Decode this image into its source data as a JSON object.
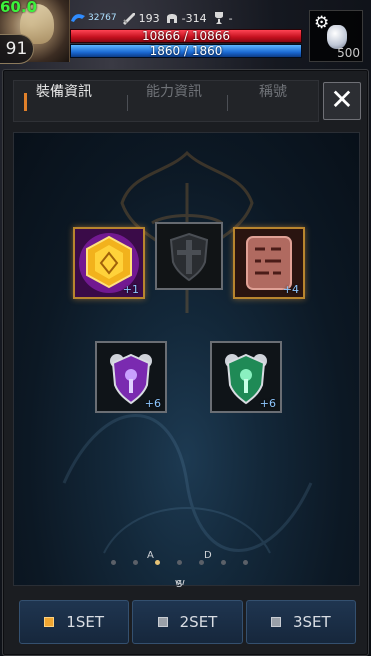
{
  "hud": {
    "fps": "60.0",
    "level": "91",
    "stats": [
      {
        "icon": "mana-wave-icon",
        "value": "32767"
      },
      {
        "icon": "sword-icon",
        "value": "193"
      },
      {
        "icon": "helmet-icon",
        "value": "-314"
      },
      {
        "icon": "trophy-icon",
        "value": "-"
      }
    ],
    "hp_text": "10866 / 10866",
    "hp_fraction": 1.0,
    "mp_text": "1860 / 1860",
    "mp_fraction": 1.0,
    "potion_count": "500",
    "colors": {
      "hp": "#d11a28",
      "mp": "#1e6fd8",
      "fps": "#3cf23c"
    }
  },
  "panel": {
    "tabs": [
      {
        "label": "裝備資訊",
        "active": true
      },
      {
        "label": "能力資訊",
        "active": false
      },
      {
        "label": "稱號",
        "active": false
      }
    ],
    "close_label": "✕",
    "slots": [
      {
        "id": "slot-1",
        "item_icon": "golden-rune-gem-icon",
        "enhance": "+1",
        "rarity": "legendary"
      },
      {
        "id": "slot-2",
        "item_icon": "empty-shield-slot-icon",
        "enhance": "",
        "rarity": "empty"
      },
      {
        "id": "slot-3",
        "item_icon": "rune-stone-tablet-icon",
        "enhance": "+4",
        "rarity": "legendary"
      },
      {
        "id": "slot-4",
        "item_icon": "purple-crest-shield-icon",
        "enhance": "+6",
        "rarity": "normal"
      },
      {
        "id": "slot-5",
        "item_icon": "green-crest-shield-icon",
        "enhance": "+6",
        "rarity": "normal"
      }
    ],
    "compass": {
      "n": "W",
      "w": "A",
      "e": "D",
      "s": "S"
    },
    "page_dots": 7,
    "active_dot": 3,
    "sets": [
      {
        "label": "1SET",
        "active": true
      },
      {
        "label": "2SET",
        "active": false
      },
      {
        "label": "3SET",
        "active": false
      }
    ],
    "accent": "#e0802a"
  }
}
